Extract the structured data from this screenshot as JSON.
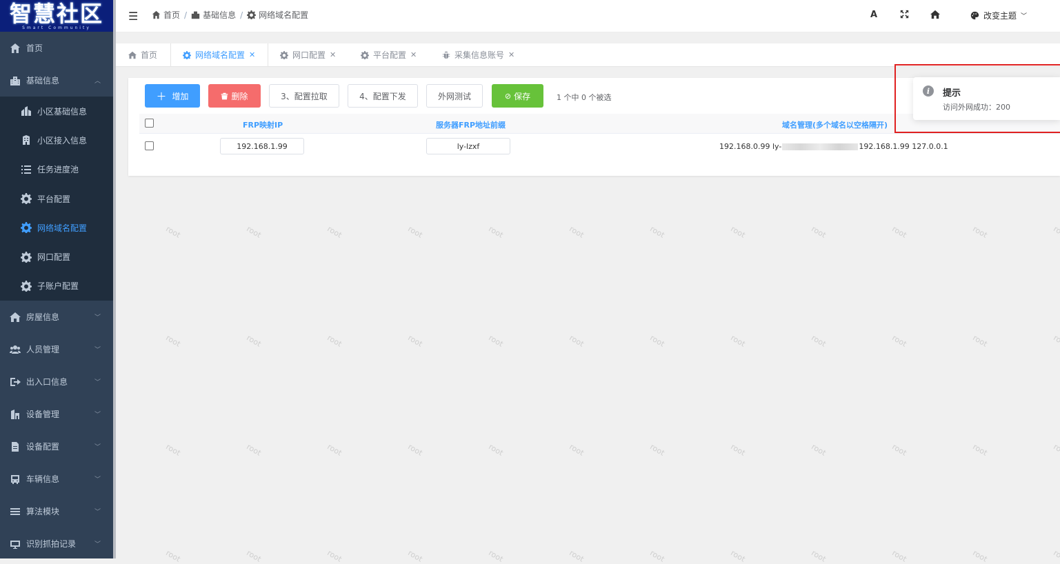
{
  "logo": {
    "title": "智慧社区",
    "subtitle": "Smart Community"
  },
  "sidebar": {
    "items": [
      {
        "label": "首页",
        "icon": "home-icon"
      },
      {
        "label": "基础信息",
        "icon": "building-icon",
        "expanded": true,
        "children": [
          {
            "label": "小区基础信息",
            "icon": "community-icon"
          },
          {
            "label": "小区接入信息",
            "icon": "building-access-icon"
          },
          {
            "label": "任务进度池",
            "icon": "list-icon"
          },
          {
            "label": "平台配置",
            "icon": "gear-icon"
          },
          {
            "label": "网络域名配置",
            "icon": "gear-icon",
            "active": true
          },
          {
            "label": "网口配置",
            "icon": "gear-icon"
          },
          {
            "label": "子账户配置",
            "icon": "gear-icon"
          }
        ]
      },
      {
        "label": "房屋信息",
        "icon": "house-icon"
      },
      {
        "label": "人员管理",
        "icon": "people-icon"
      },
      {
        "label": "出入口信息",
        "icon": "exit-icon"
      },
      {
        "label": "设备管理",
        "icon": "device-icon"
      },
      {
        "label": "设备配置",
        "icon": "document-icon"
      },
      {
        "label": "车辆信息",
        "icon": "bus-icon"
      },
      {
        "label": "算法模块",
        "icon": "menu-icon"
      },
      {
        "label": "识别抓拍记录",
        "icon": "camera-icon"
      }
    ]
  },
  "navbar": {
    "breadcrumb": [
      "首页",
      "基础信息",
      "网络域名配置"
    ],
    "font_size_label": "A",
    "theme_label": "改变主题"
  },
  "tags": [
    {
      "label": "首页",
      "icon": "home-icon"
    },
    {
      "label": "网络域名配置",
      "icon": "gear-icon",
      "active": true
    },
    {
      "label": "网口配置",
      "icon": "gear-icon"
    },
    {
      "label": "平台配置",
      "icon": "gear-icon"
    },
    {
      "label": "采集信息账号",
      "icon": "bug-icon"
    }
  ],
  "toolbar": {
    "add": "增加",
    "delete": "删除",
    "pull": "3、配置拉取",
    "push": "4、配置下发",
    "test": "外网测试",
    "save": "保存",
    "selection": "1 个中 0 个被选"
  },
  "table": {
    "columns": [
      "FRP映射IP",
      "服务器FRP地址前缀",
      "域名管理(多个域名以空格隔开)"
    ],
    "rows": [
      {
        "frp_ip": "192.168.1.99",
        "frp_prefix": "ly-lzxf",
        "domains_start": "192.168.0.99 ly-",
        "domains_end": "192.168.1.99 127.0.0.1"
      }
    ]
  },
  "watermark": "root",
  "notification": {
    "title": "提示",
    "message": "访问外网成功：200"
  },
  "colors": {
    "sidebar": "#304156",
    "primary": "#409eff",
    "danger": "#f56c6c",
    "success": "#67c23a",
    "highlight": "#e02020"
  }
}
